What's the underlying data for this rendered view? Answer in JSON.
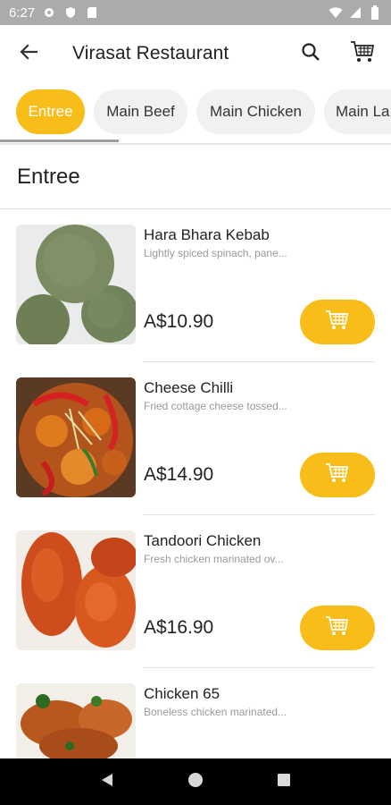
{
  "status_bar": {
    "time": "6:27",
    "icons": [
      "gear-icon",
      "shield-icon",
      "sd-card-icon",
      "wifi-icon",
      "signal-icon",
      "battery-icon"
    ]
  },
  "app_bar": {
    "title": "Virasat Restaurant",
    "back_icon": "arrow-back-icon",
    "search_icon": "search-icon",
    "cart_icon": "cart-icon"
  },
  "tabs": [
    {
      "label": "Entree",
      "active": true
    },
    {
      "label": "Main Beef",
      "active": false
    },
    {
      "label": "Main Chicken",
      "active": false
    },
    {
      "label": "Main La",
      "active": false
    }
  ],
  "section": {
    "title": "Entree"
  },
  "items": [
    {
      "name": "Hara Bhara Kebab",
      "description": "Lightly spiced spinach, pane...",
      "price": "A$10.90"
    },
    {
      "name": "Cheese Chilli",
      "description": "Fried cottage cheese tossed...",
      "price": "A$14.90"
    },
    {
      "name": "Tandoori Chicken",
      "description": "Fresh chicken marinated ov...",
      "price": "A$16.90"
    },
    {
      "name": "Chicken 65",
      "description": "Boneless chicken marinated...",
      "price": ""
    }
  ],
  "colors": {
    "accent": "#f9bd1a",
    "status_bar": "#ababab",
    "nav_bar": "#000000"
  }
}
